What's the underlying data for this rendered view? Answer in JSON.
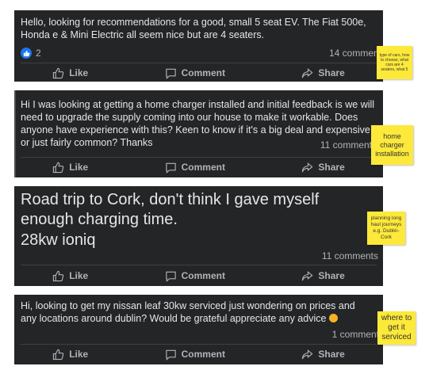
{
  "posts": [
    {
      "text": "Hello, looking for recommendations for a good, small 5 seat EV. The Fiat 500e, Honda e & Mini Electric all seem nice but are 4 seaters.",
      "reaction_count": "2",
      "comments": "14 comments",
      "like": "Like",
      "comment": "Comment",
      "share": "Share",
      "note": "type of cars, how to choose, what cars are 4 seaters, what 5"
    },
    {
      "text": "Hi I was looking at getting a home charger installed and initial feedback is we will need to upgrade the supply coming into our house to make it workable. Does anyone have experience with this? Keen to know if it's a big deal and expensive or just fairly common? Thanks",
      "comments": "11 comments",
      "like": "Like",
      "comment": "Comment",
      "share": "Share",
      "note": "home charger installation"
    },
    {
      "text": "Road trip to Cork, don't think I gave myself enough charging time.",
      "text2": "28kw ioniq",
      "comments": "11 comments",
      "like": "Like",
      "comment": "Comment",
      "share": "Share",
      "note": "planning long haul journeys e.g. Dublin-Cork"
    },
    {
      "text": "Hi, looking to get my nissan leaf 30kw serviced just wondering on prices and any locations around dublin? Would be grateful appreciate any advice",
      "comments": "1 comment",
      "like": "Like",
      "comment": "Comment",
      "share": "Share",
      "note": "where to get it serviced"
    }
  ],
  "colors": {
    "post_bg": "#242526",
    "text": "#e4e6eb",
    "muted": "#b0b3b8",
    "note": "#fde93a",
    "like_blue": "#1877f2"
  },
  "icons": [
    "thumbs-up-icon",
    "comment-icon",
    "share-icon",
    "like-reaction-icon",
    "smile-emoji-icon"
  ]
}
